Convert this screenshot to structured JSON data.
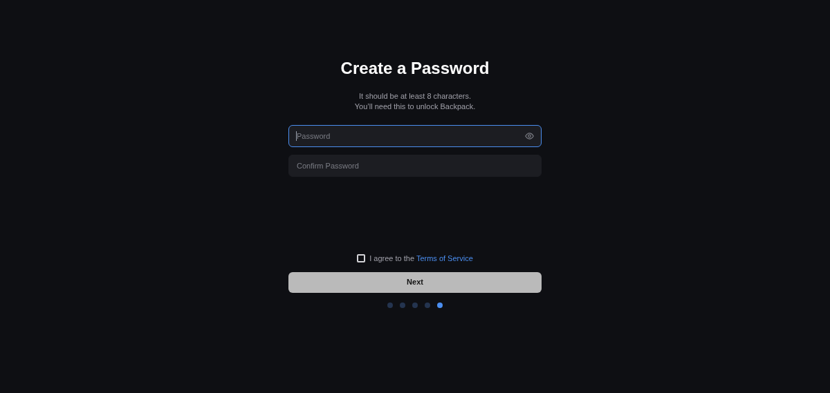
{
  "title": "Create a Password",
  "subtitle_lines": [
    "It should be at least 8 characters.",
    "You’ll need this to unlock Backpack."
  ],
  "fields": [
    {
      "placeholder": "Password",
      "focused": true,
      "kind": "reveal"
    },
    {
      "placeholder": "Confirm Password",
      "focused": false,
      "kind": "plain"
    }
  ],
  "agreement": {
    "checked": false,
    "text": "I agree to the ",
    "link": "Terms of Service"
  },
  "next_button": {
    "label": "Next"
  },
  "steps": [
    {
      "selected": false
    },
    {
      "selected": false
    },
    {
      "selected": false
    },
    {
      "selected": false
    },
    {
      "selected": true
    }
  ]
}
